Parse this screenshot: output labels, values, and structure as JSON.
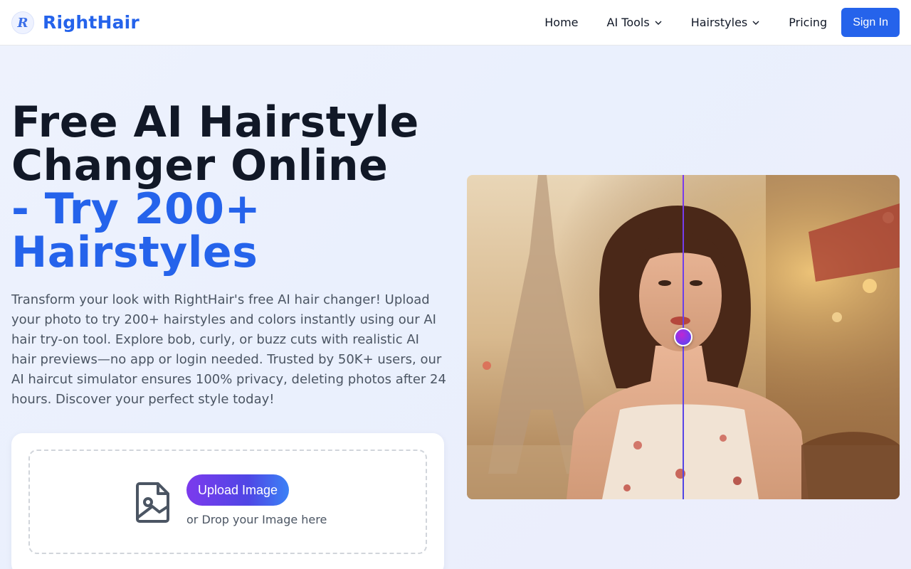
{
  "header": {
    "brand_logo_letter": "R",
    "brand_name": "RightHair",
    "nav": {
      "home": "Home",
      "ai_tools": "AI Tools",
      "hairstyles": "Hairstyles",
      "pricing": "Pricing"
    },
    "sign_in": "Sign In"
  },
  "hero": {
    "title_line1": "Free AI Hairstyle",
    "title_line2": "Changer Online",
    "title_accent_line1": "- Try 200+",
    "title_accent_line2": "Hairstyles",
    "description": "Transform your look with RightHair's free AI hair changer! Upload your photo to try 200+ hairstyles and colors instantly using our AI hair try-on tool. Explore bob, curly, or buzz cuts with realistic AI hair previews—no app or login needed. Trusted by 50K+ users, our AI haircut simulator ensures 100% privacy, deleting photos after 24 hours. Discover your perfect style today!"
  },
  "upload": {
    "button_label": "Upload Image",
    "drop_hint": "or Drop your Image here",
    "icon": "image-upload-icon"
  },
  "comparison": {
    "split_position": 0.5
  },
  "colors": {
    "brand": "#2563eb",
    "heading": "#111827",
    "body_text": "#4b5563",
    "upload_gradient_start": "#7c3aed",
    "upload_gradient_end": "#3b82f6"
  }
}
